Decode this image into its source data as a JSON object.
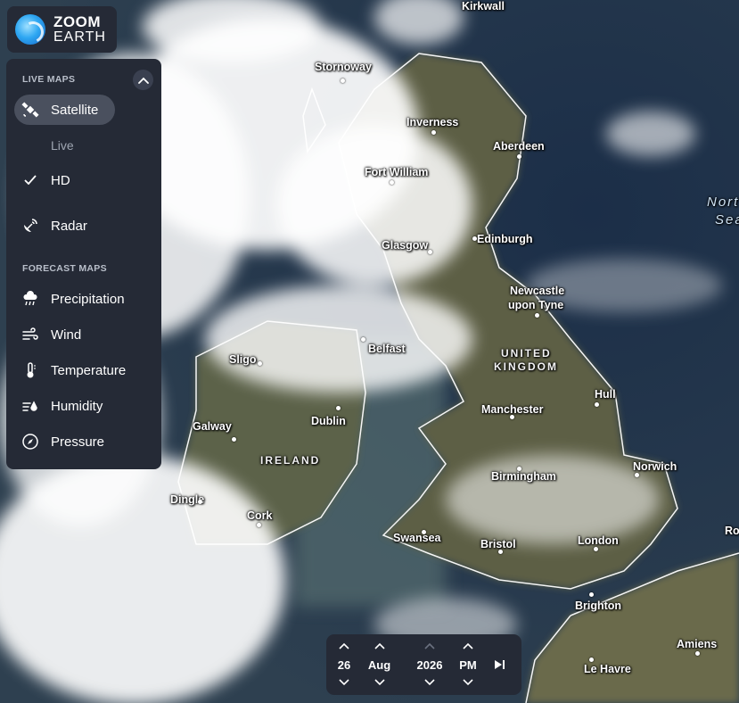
{
  "app": {
    "logo_line1": "ZOOM",
    "logo_line2": "EARTH"
  },
  "panel": {
    "live_maps_header": "LIVE MAPS",
    "satellite_label": "Satellite",
    "live_label": "Live",
    "hd_label": "HD",
    "radar_label": "Radar",
    "forecast_header": "FORECAST MAPS",
    "forecast_items": [
      "Precipitation",
      "Wind",
      "Temperature",
      "Humidity",
      "Pressure"
    ]
  },
  "datebar": {
    "day": "26",
    "month": "Aug",
    "year": "2026",
    "ampm": "PM"
  },
  "map_labels": {
    "kirkwall": "Kirkwall",
    "stornoway": "Stornoway",
    "inverness": "Inverness",
    "aberdeen": "Aberdeen",
    "fort_william": "Fort William",
    "north_sea_1": "Nort",
    "north_sea_2": "Sea",
    "edinburgh": "Edinburgh",
    "glasgow": "Glasgow",
    "newcastle_1": "Newcastle",
    "newcastle_2": "upon Tyne",
    "belfast": "Belfast",
    "sligo": "Sligo",
    "uk_1": "UNITED",
    "uk_2": "KINGDOM",
    "hull": "Hull",
    "manchester": "Manchester",
    "dublin": "Dublin",
    "galway": "Galway",
    "ireland": "IRELAND",
    "norwich": "Norwich",
    "birmingham": "Birmingham",
    "dingle": "Dingle",
    "cork": "Cork",
    "ro": "Ro",
    "swansea": "Swansea",
    "bristol": "Bristol",
    "london": "London",
    "brighton": "Brighton",
    "amiens": "Amiens",
    "le_havre": "Le Havre"
  },
  "colors": {
    "panel_bg": "#252a36",
    "ocean": "#1c2a3a",
    "selected_bg": "#4a505e"
  }
}
